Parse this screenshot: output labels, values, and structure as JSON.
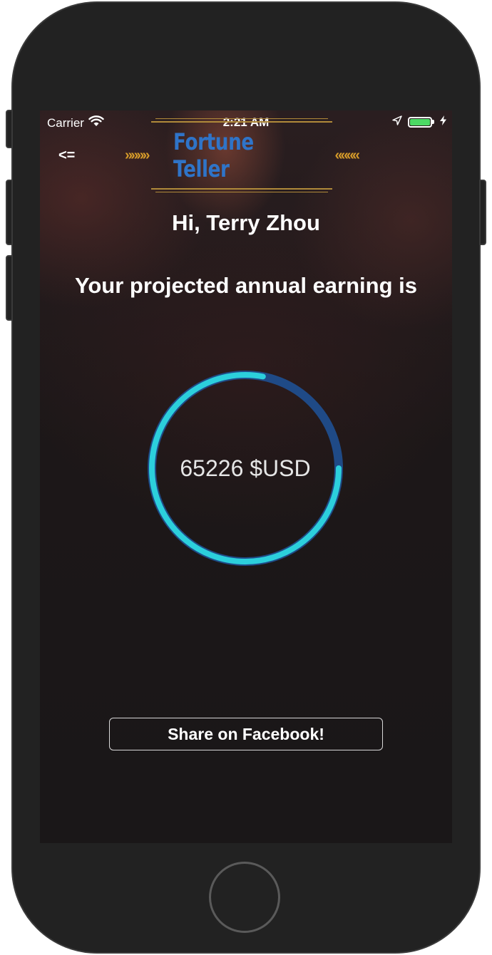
{
  "status_bar": {
    "carrier": "Carrier",
    "time": "2:21 AM",
    "battery_color": "#4cd964",
    "icons": [
      "wifi-icon",
      "location-arrow-icon",
      "battery-icon",
      "charging-bolt-icon"
    ]
  },
  "nav": {
    "back_label": "<=",
    "logo_text": "Fortune Teller",
    "logo_color": "#2f74c8",
    "ornament_color": "#d49a2a"
  },
  "content": {
    "greeting": "Hi, Terry Zhou",
    "subtitle": "Your projected annual earning is",
    "earning_value": "65226 $USD",
    "ring_progress": 0.78,
    "ring_track_color": "#1f4a86",
    "ring_fill_color": "#2ccfdc"
  },
  "actions": {
    "share_label": "Share on Facebook!"
  }
}
